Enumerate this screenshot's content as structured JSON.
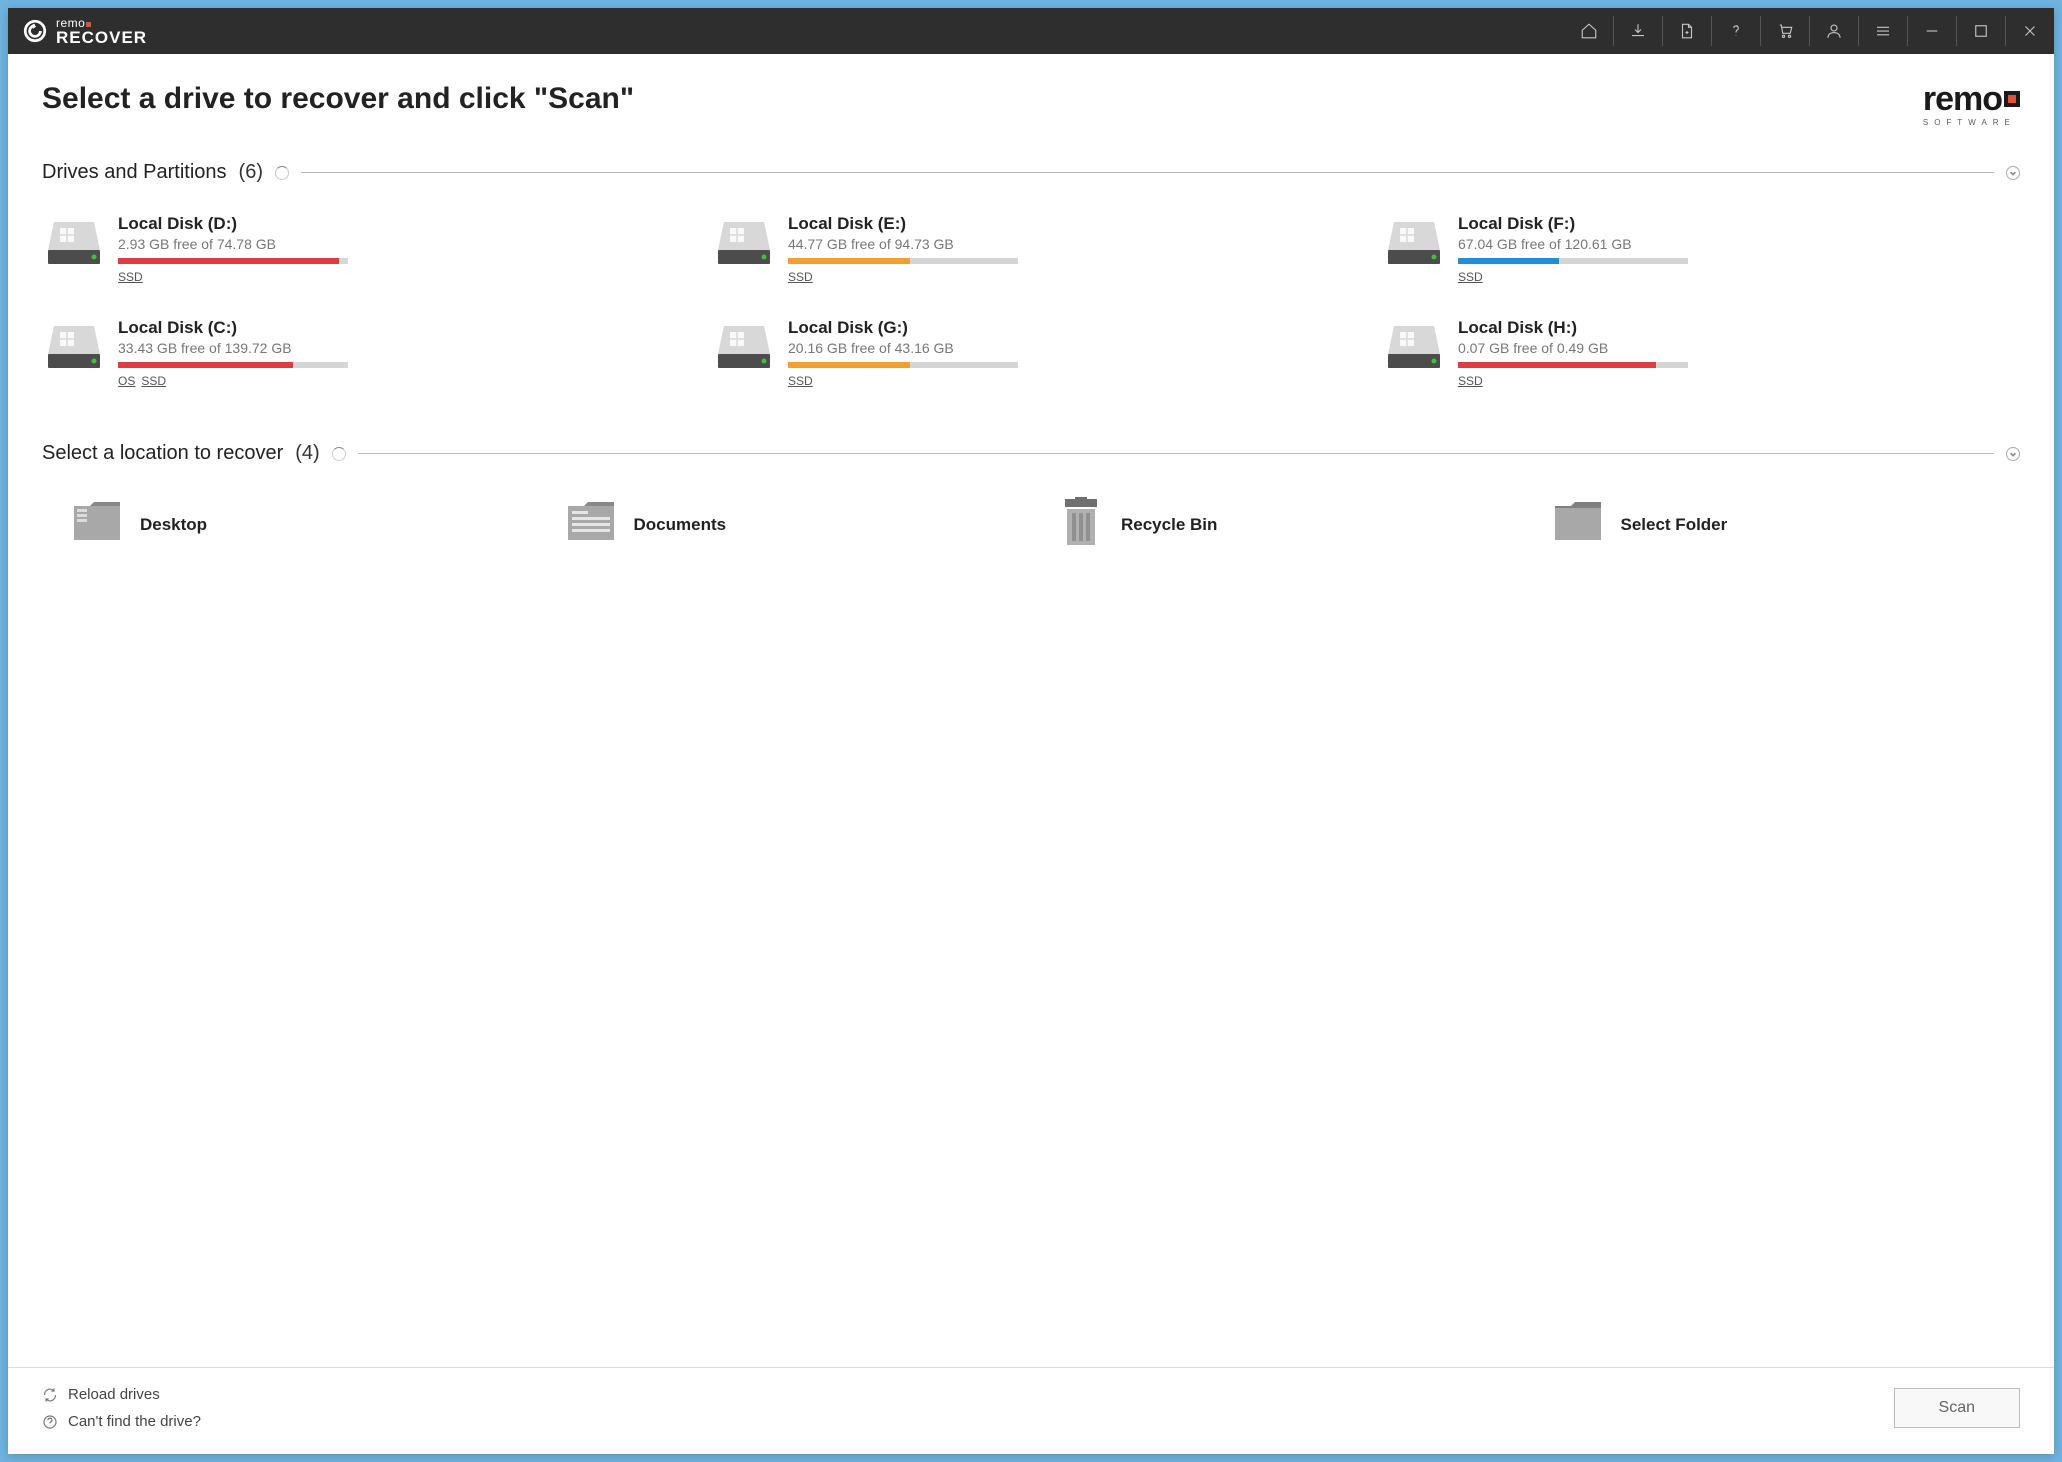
{
  "titlebar": {
    "brand_top": "remo",
    "brand_bottom": "RECOVER"
  },
  "header": {
    "title": "Select a drive to recover and click \"Scan\"",
    "brand_name": "remo",
    "brand_sub": "SOFTWARE"
  },
  "sections": {
    "drives": {
      "label": "Drives and Partitions",
      "count": "(6)"
    },
    "locations": {
      "label": "Select a location to recover",
      "count": "(4)"
    }
  },
  "drives": [
    {
      "name": "Local Disk (D:)",
      "free": "2.93 GB free of 74.78 GB",
      "used_pct": 96,
      "color": "red",
      "tags": [
        "SSD"
      ]
    },
    {
      "name": "Local Disk (E:)",
      "free": "44.77 GB free of 94.73 GB",
      "used_pct": 53,
      "color": "orange",
      "tags": [
        "SSD"
      ]
    },
    {
      "name": "Local Disk (F:)",
      "free": "67.04 GB free of 120.61 GB",
      "used_pct": 44,
      "color": "blue",
      "tags": [
        "SSD"
      ]
    },
    {
      "name": "Local Disk (C:)",
      "free": "33.43 GB free of 139.72 GB",
      "used_pct": 76,
      "color": "red",
      "tags": [
        "OS",
        "SSD"
      ]
    },
    {
      "name": "Local Disk (G:)",
      "free": "20.16 GB free of 43.16 GB",
      "used_pct": 53,
      "color": "orange",
      "tags": [
        "SSD"
      ]
    },
    {
      "name": "Local Disk (H:)",
      "free": "0.07 GB free of 0.49 GB",
      "used_pct": 86,
      "color": "red",
      "tags": [
        "SSD"
      ]
    }
  ],
  "locations": [
    {
      "name": "Desktop",
      "icon": "desktop"
    },
    {
      "name": "Documents",
      "icon": "documents"
    },
    {
      "name": "Recycle Bin",
      "icon": "trash"
    },
    {
      "name": "Select Folder",
      "icon": "folder"
    }
  ],
  "footer": {
    "reload": "Reload drives",
    "help": "Can't find the drive?",
    "scan": "Scan"
  }
}
